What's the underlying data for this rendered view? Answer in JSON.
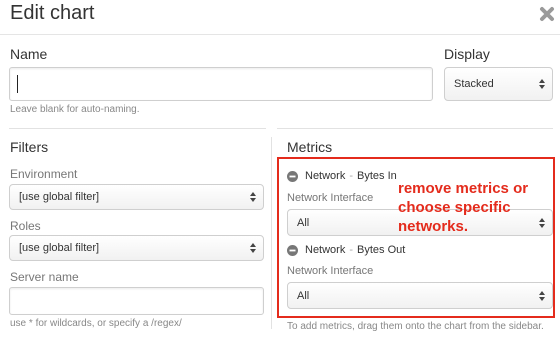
{
  "dialog": {
    "title": "Edit chart",
    "close_icon": "close-x-icon"
  },
  "name": {
    "label": "Name",
    "value": "",
    "hint": "Leave blank for auto-naming."
  },
  "display": {
    "label": "Display",
    "selected": "Stacked"
  },
  "filters": {
    "label": "Filters",
    "environment": {
      "label": "Environment",
      "selected": "[use global filter]"
    },
    "roles": {
      "label": "Roles",
      "selected": "[use global filter]"
    },
    "server_name": {
      "label": "Server name",
      "value": "",
      "hint": "use * for wildcards, or specify a /regex/"
    }
  },
  "metrics": {
    "label": "Metrics",
    "items": [
      {
        "group": "Network",
        "separator": "-",
        "name": "Bytes In",
        "field_label": "Network Interface",
        "selected": "All",
        "icon": "remove-circle-icon"
      },
      {
        "group": "Network",
        "separator": "-",
        "name": "Bytes Out",
        "field_label": "Network Interface",
        "selected": "All",
        "icon": "remove-circle-icon"
      }
    ],
    "footer": "To add metrics, drag them onto the chart from the sidebar."
  },
  "annotation": {
    "text": "remove metrics or\nchoose specific\nnetworks.",
    "color": "#e42b1c"
  },
  "colors": {
    "accent_red": "#e42b1c",
    "text": "#333333",
    "muted": "#777777"
  }
}
